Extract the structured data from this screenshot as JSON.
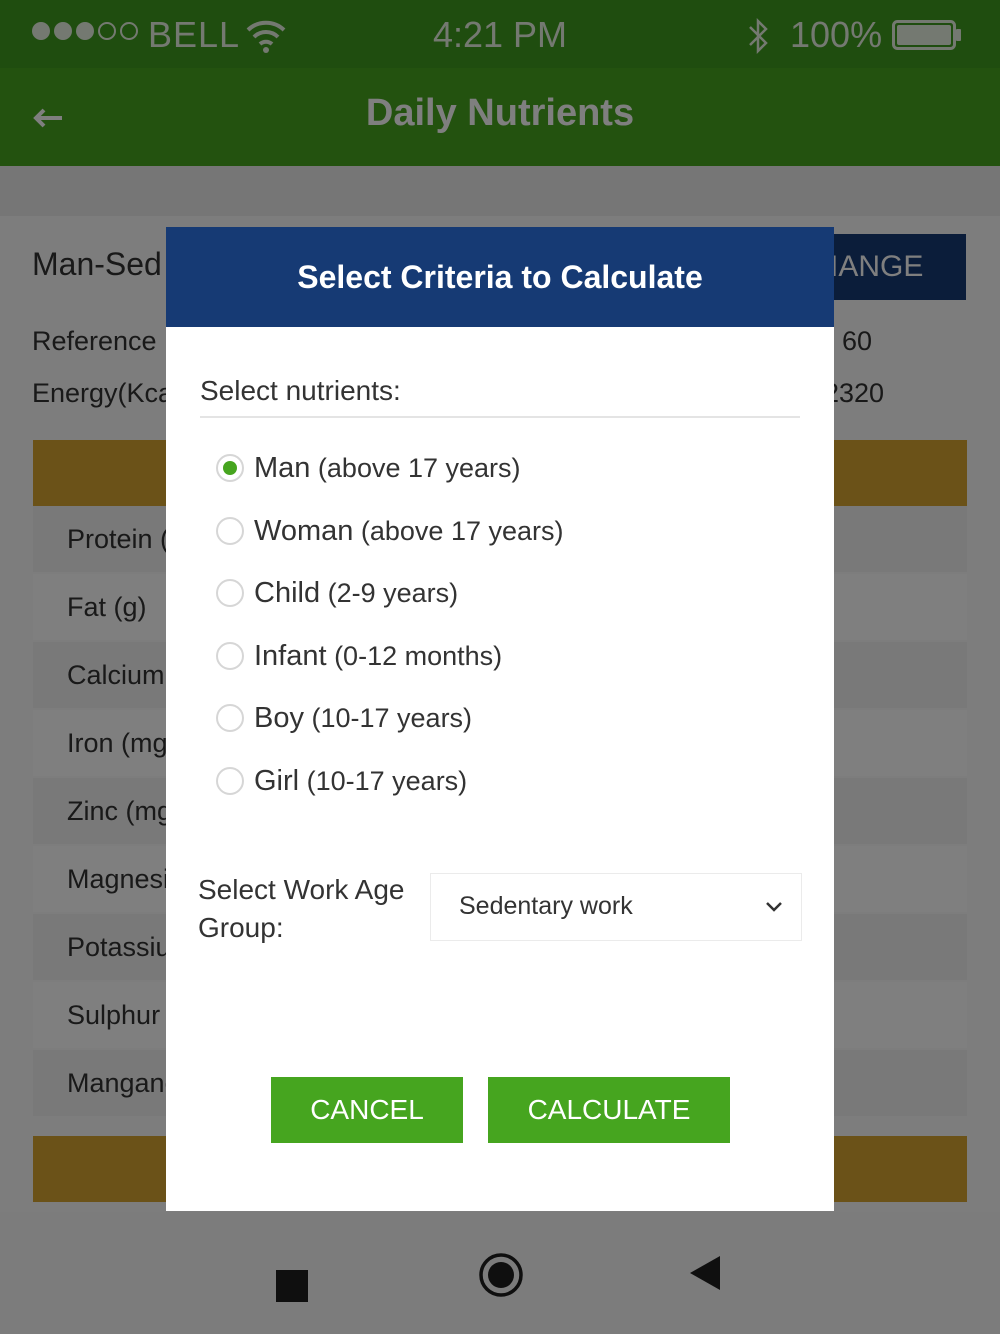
{
  "status_bar": {
    "carrier": "BELL",
    "time": "4:21 PM",
    "battery": "100%",
    "signal_filled": 3,
    "signal_total": 5
  },
  "app_bar": {
    "title": "Daily Nutrients",
    "back_icon": "arrow-left-icon"
  },
  "background_page": {
    "title_partial": "Man-Sed",
    "change_button_partial": "IANGE",
    "reference_label_partial": "Reference I",
    "reference_value_partial": "60",
    "energy_label_partial": "Energy(Kca",
    "energy_value_partial": "2320",
    "nutrient_rows": [
      "Protein (",
      "Fat (g)",
      "Calcium",
      "Iron (mg)",
      "Zinc (mg",
      "Magnesi",
      "Potassiu",
      "Sulphur",
      "Mangane"
    ]
  },
  "dialog": {
    "title": "Select Criteria to Calculate",
    "nutrients_label": "Select nutrients:",
    "options": [
      {
        "main": "Man",
        "sub": " (above 17 years)",
        "checked": true
      },
      {
        "main": "Woman",
        "sub": " (above 17 years)",
        "checked": false
      },
      {
        "main": "Child",
        "sub": " (2-9 years)",
        "checked": false
      },
      {
        "main": "Infant",
        "sub": " (0-12 months)",
        "checked": false
      },
      {
        "main": "Boy",
        "sub": " (10-17 years)",
        "checked": false
      },
      {
        "main": "Girl",
        "sub": " (10-17 years)",
        "checked": false
      }
    ],
    "work_group_label": "Select Work Age Group:",
    "work_group_value": "Sedentary work",
    "cancel_label": "CANCEL",
    "calculate_label": "CALCULATE"
  },
  "nav_bar": {
    "icons": [
      "recent-apps-icon",
      "home-icon",
      "back-triangle-icon"
    ]
  },
  "colors": {
    "status_bar": "#3f9a1e",
    "app_bar": "#46a51f",
    "dialog_header": "#163a74",
    "button": "#46a51f",
    "gold_band": "#d7a531"
  }
}
